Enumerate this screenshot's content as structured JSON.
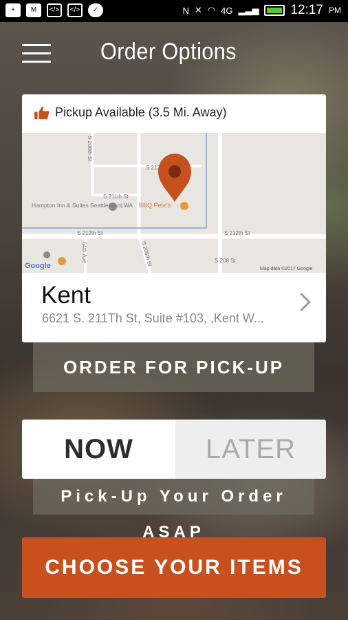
{
  "status_bar": {
    "time": "12:17",
    "ampm": "PM",
    "network": "4G",
    "icons": [
      "add-box-icon",
      "gmail-icon",
      "code-icon",
      "code-icon",
      "check-circle-icon",
      "nfc-icon",
      "mute-icon",
      "wifi-icon",
      "signal-icon",
      "battery-charging-icon"
    ]
  },
  "header": {
    "title": "Order Options"
  },
  "pickup_card": {
    "pickup_label": "Pickup Available (3.5 Mi. Away)",
    "location_name": "Kent",
    "address": "6621 S. 211Th St, Suite #103, ,Kent W...",
    "map": {
      "streets": [
        "S 212th St",
        "S 211th St",
        "S 212th St",
        "S 212th St",
        "S 208th St",
        "S 206th St",
        "64th Ave",
        "S 208 St"
      ],
      "pois": [
        "Hampton Inn & Suites Seattle/Kent,WA",
        "BBQ Pete's"
      ],
      "attribution": "Map data ©2017 Google",
      "logo": "Google"
    }
  },
  "actions": {
    "order_pickup": "ORDER FOR PICK-UP",
    "now": "NOW",
    "later": "LATER",
    "asap": "Pick-Up Your Order ASAP",
    "choose_items": "CHOOSE YOUR ITEMS"
  },
  "colors": {
    "accent": "#c8501e",
    "pin": "#c5511f",
    "toggle_selected_text": "#2a2e33",
    "toggle_unselected_text": "#aaaaaa"
  }
}
